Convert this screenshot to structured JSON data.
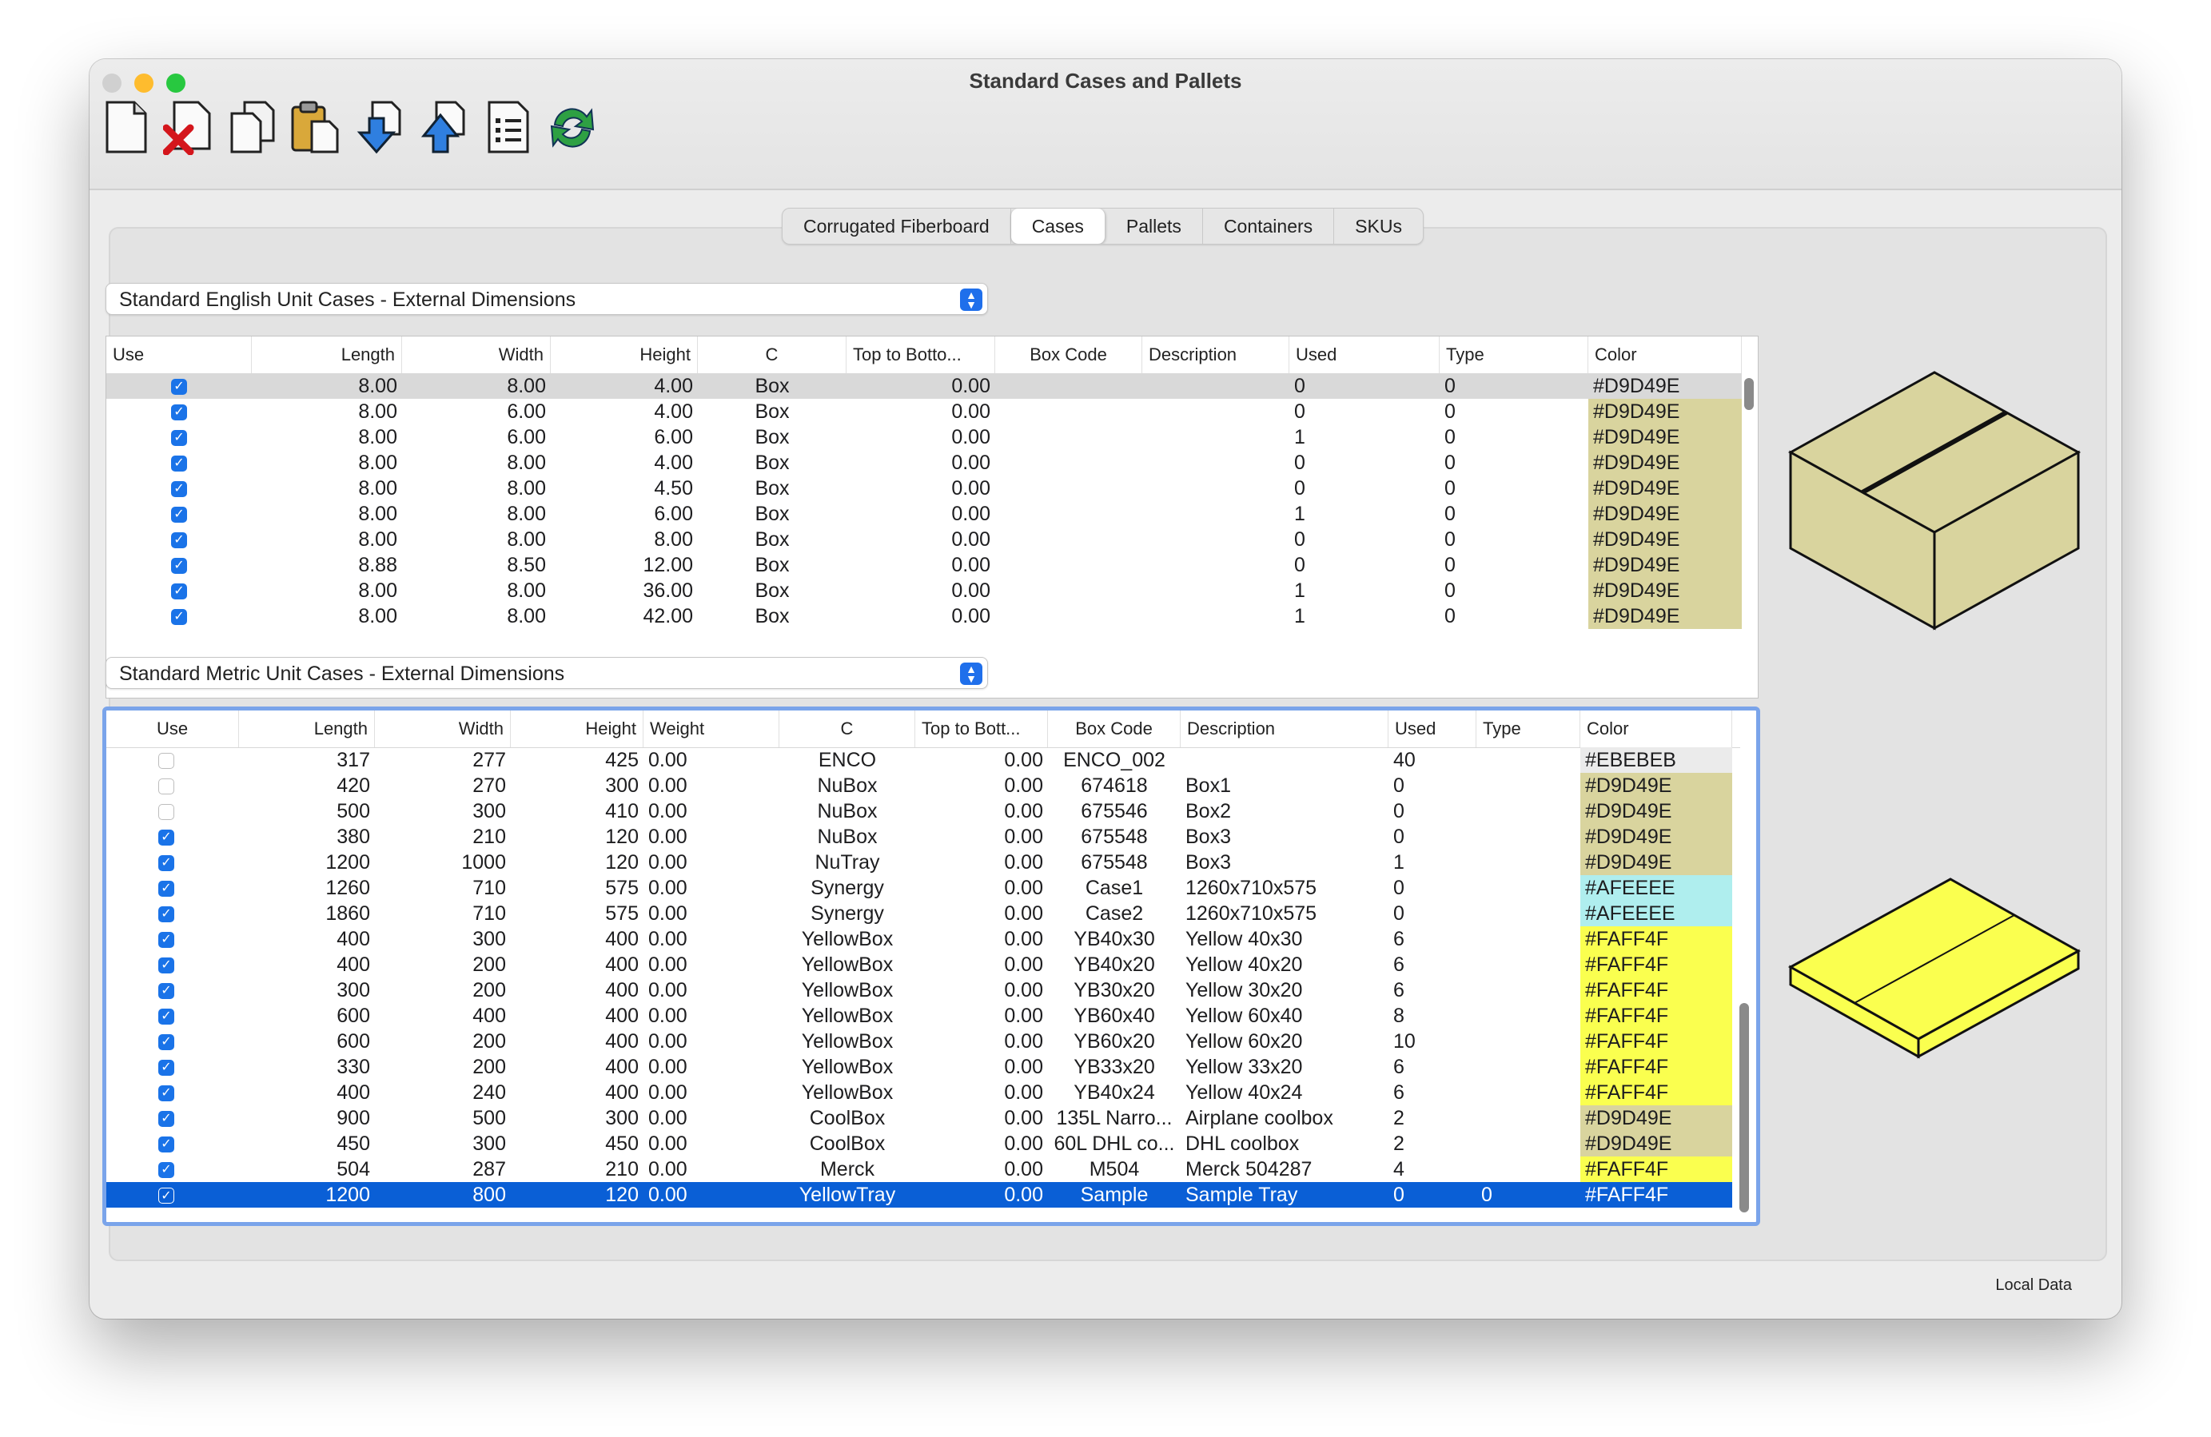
{
  "window": {
    "title": "Standard Cases and Pallets",
    "status": "Local Data"
  },
  "traffic_lights": {
    "close": "#bfbfbf",
    "minimize": "#febc2e",
    "zoom": "#28c840"
  },
  "toolbar": [
    {
      "name": "new-file-icon"
    },
    {
      "name": "delete-file-icon"
    },
    {
      "name": "copy-icon"
    },
    {
      "name": "paste-icon"
    },
    {
      "name": "import-icon"
    },
    {
      "name": "export-icon"
    },
    {
      "name": "list-icon"
    },
    {
      "name": "refresh-icon"
    }
  ],
  "tabs": [
    {
      "label": "Corrugated Fiberboard",
      "active": false
    },
    {
      "label": "Cases",
      "active": true
    },
    {
      "label": "Pallets",
      "active": false
    },
    {
      "label": "Containers",
      "active": false
    },
    {
      "label": "SKUs",
      "active": false
    }
  ],
  "english": {
    "dropdown": "Standard English Unit Cases - External Dimensions",
    "headers": [
      "Use",
      "Length",
      "Width",
      "Height",
      "C",
      "Top to Botto...",
      "Box Code",
      "Description",
      "Used",
      "Type",
      "Color"
    ],
    "rows": [
      [
        true,
        "8.00",
        "8.00",
        "4.00",
        "Box",
        "0.00",
        "",
        "",
        "0",
        "0",
        "#D9D49E"
      ],
      [
        true,
        "8.00",
        "6.00",
        "4.00",
        "Box",
        "0.00",
        "",
        "",
        "0",
        "0",
        "#D9D49E"
      ],
      [
        true,
        "8.00",
        "6.00",
        "6.00",
        "Box",
        "0.00",
        "",
        "",
        "1",
        "0",
        "#D9D49E"
      ],
      [
        true,
        "8.00",
        "8.00",
        "4.00",
        "Box",
        "0.00",
        "",
        "",
        "0",
        "0",
        "#D9D49E"
      ],
      [
        true,
        "8.00",
        "8.00",
        "4.50",
        "Box",
        "0.00",
        "",
        "",
        "0",
        "0",
        "#D9D49E"
      ],
      [
        true,
        "8.00",
        "8.00",
        "6.00",
        "Box",
        "0.00",
        "",
        "",
        "1",
        "0",
        "#D9D49E"
      ],
      [
        true,
        "8.00",
        "8.00",
        "8.00",
        "Box",
        "0.00",
        "",
        "",
        "0",
        "0",
        "#D9D49E"
      ],
      [
        true,
        "8.88",
        "8.50",
        "12.00",
        "Box",
        "0.00",
        "",
        "",
        "0",
        "0",
        "#D9D49E"
      ],
      [
        true,
        "8.00",
        "8.00",
        "36.00",
        "Box",
        "0.00",
        "",
        "",
        "1",
        "0",
        "#D9D49E"
      ],
      [
        true,
        "8.00",
        "8.00",
        "42.00",
        "Box",
        "0.00",
        "",
        "",
        "1",
        "0",
        "#D9D49E"
      ]
    ]
  },
  "metric": {
    "dropdown": "Standard Metric Unit Cases - External Dimensions",
    "headers": [
      "Use",
      "Length",
      "Width",
      "Height",
      "Weight",
      "C",
      "Top to Bott...",
      "Box Code",
      "Description",
      "Used",
      "Type",
      "Color"
    ],
    "rows": [
      [
        false,
        "317",
        "277",
        "425",
        "0.00",
        "ENCO",
        "0.00",
        "ENCO_002",
        "",
        "40",
        "",
        "#EBEBEB"
      ],
      [
        false,
        "420",
        "270",
        "300",
        "0.00",
        "NuBox",
        "0.00",
        "674618",
        "Box1",
        "0",
        "",
        "#D9D49E"
      ],
      [
        false,
        "500",
        "300",
        "410",
        "0.00",
        "NuBox",
        "0.00",
        "675546",
        "Box2",
        "0",
        "",
        "#D9D49E"
      ],
      [
        true,
        "380",
        "210",
        "120",
        "0.00",
        "NuBox",
        "0.00",
        "675548",
        "Box3",
        "0",
        "",
        "#D9D49E"
      ],
      [
        true,
        "1200",
        "1000",
        "120",
        "0.00",
        "NuTray",
        "0.00",
        "675548",
        "Box3",
        "1",
        "",
        "#D9D49E"
      ],
      [
        true,
        "1260",
        "710",
        "575",
        "0.00",
        "Synergy",
        "0.00",
        "Case1",
        "1260x710x575",
        "0",
        "",
        "#AFEEEE"
      ],
      [
        true,
        "1860",
        "710",
        "575",
        "0.00",
        "Synergy",
        "0.00",
        "Case2",
        "1260x710x575",
        "0",
        "",
        "#AFEEEE"
      ],
      [
        true,
        "400",
        "300",
        "400",
        "0.00",
        "YellowBox",
        "0.00",
        "YB40x30",
        "Yellow 40x30",
        "6",
        "",
        "#FAFF4F"
      ],
      [
        true,
        "400",
        "200",
        "400",
        "0.00",
        "YellowBox",
        "0.00",
        "YB40x20",
        "Yellow 40x20",
        "6",
        "",
        "#FAFF4F"
      ],
      [
        true,
        "300",
        "200",
        "400",
        "0.00",
        "YellowBox",
        "0.00",
        "YB30x20",
        "Yellow 30x20",
        "6",
        "",
        "#FAFF4F"
      ],
      [
        true,
        "600",
        "400",
        "400",
        "0.00",
        "YellowBox",
        "0.00",
        "YB60x40",
        "Yellow 60x40",
        "8",
        "",
        "#FAFF4F"
      ],
      [
        true,
        "600",
        "200",
        "400",
        "0.00",
        "YellowBox",
        "0.00",
        "YB60x20",
        "Yellow 60x20",
        "10",
        "",
        "#FAFF4F"
      ],
      [
        true,
        "330",
        "200",
        "400",
        "0.00",
        "YellowBox",
        "0.00",
        "YB33x20",
        "Yellow 33x20",
        "6",
        "",
        "#FAFF4F"
      ],
      [
        true,
        "400",
        "240",
        "400",
        "0.00",
        "YellowBox",
        "0.00",
        "YB40x24",
        "Yellow 40x24",
        "6",
        "",
        "#FAFF4F"
      ],
      [
        true,
        "900",
        "500",
        "300",
        "0.00",
        "CoolBox",
        "0.00",
        "135L Narro...",
        "Airplane coolbox",
        "2",
        "",
        "#D9D49E"
      ],
      [
        true,
        "450",
        "300",
        "450",
        "0.00",
        "CoolBox",
        "0.00",
        "60L DHL co...",
        "DHL coolbox",
        "2",
        "",
        "#D9D49E"
      ],
      [
        true,
        "504",
        "287",
        "210",
        "0.00",
        "Merck",
        "0.00",
        "M504",
        "Merck 504287",
        "4",
        "",
        "#FAFF4F"
      ],
      [
        true,
        "1200",
        "800",
        "120",
        "0.00",
        "YellowTray",
        "0.00",
        "Sample",
        "Sample Tray",
        "0",
        "0",
        "#FAFF4F"
      ]
    ]
  }
}
